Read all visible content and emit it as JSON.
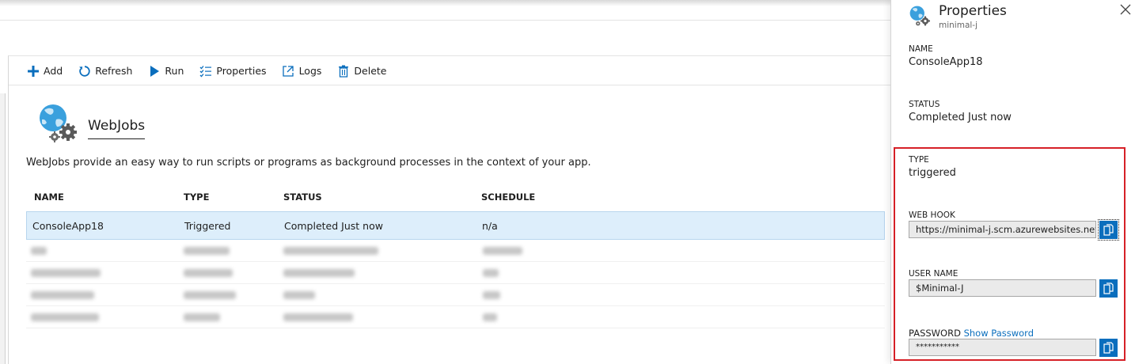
{
  "toolbar": {
    "add": "Add",
    "refresh": "Refresh",
    "run": "Run",
    "properties": "Properties",
    "logs": "Logs",
    "delete": "Delete"
  },
  "hero": {
    "title": "WebJobs",
    "description": "WebJobs provide an easy way to run scripts or programs as background processes in the context of your app."
  },
  "table": {
    "headers": [
      "NAME",
      "TYPE",
      "STATUS",
      "SCHEDULE"
    ],
    "rows": [
      {
        "name": "ConsoleApp18",
        "type": "Triggered",
        "status": "Completed Just now",
        "schedule": "n/a"
      }
    ]
  },
  "panel": {
    "title": "Properties",
    "subtitle": "minimal-j",
    "name_label": "NAME",
    "name_value": "ConsoleApp18",
    "status_label": "STATUS",
    "status_value": "Completed Just now",
    "type_label": "TYPE",
    "type_value": "triggered",
    "webhook_label": "WEB HOOK",
    "webhook_value": "https://minimal-j.scm.azurewebsites.net...",
    "username_label": "USER NAME",
    "username_value": "$Minimal-J",
    "password_label": "PASSWORD",
    "password_link": "Show Password",
    "password_value": "***********"
  },
  "colors": {
    "accent": "#0a6ebd",
    "selected_row": "#ddeefb",
    "highlight_border": "#d62027"
  }
}
